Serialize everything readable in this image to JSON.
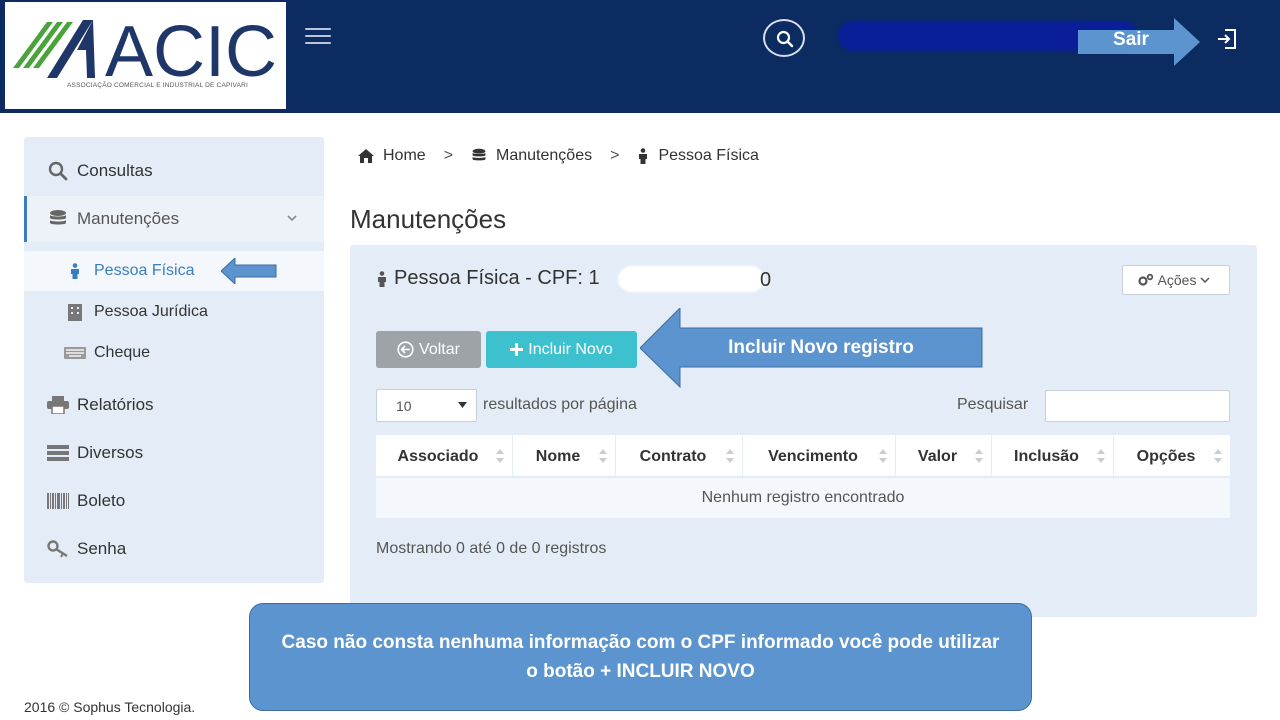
{
  "header": {
    "logo_text": "ACIC",
    "logo_subtitle": "ASSOCIAÇÃO COMERCIAL E INDUSTRIAL DE CAPIVARI",
    "sair_label": "Sair"
  },
  "sidebar": {
    "items": [
      {
        "label": "Consultas",
        "icon": "search-icon"
      },
      {
        "label": "Manutenções",
        "icon": "database-icon"
      },
      {
        "label": "Pessoa Física",
        "icon": "person-icon"
      },
      {
        "label": "Pessoa Jurídica",
        "icon": "building-icon"
      },
      {
        "label": "Cheque",
        "icon": "keyboard-icon"
      },
      {
        "label": "Relatórios",
        "icon": "printer-icon"
      },
      {
        "label": "Diversos",
        "icon": "server-icon"
      },
      {
        "label": "Boleto",
        "icon": "barcode-icon"
      },
      {
        "label": "Senha",
        "icon": "key-icon"
      }
    ]
  },
  "breadcrumb": {
    "items": [
      {
        "label": "Home",
        "icon": "home-icon"
      },
      {
        "label": "Manutenções",
        "icon": "database-icon"
      },
      {
        "label": "Pessoa Física",
        "icon": "person-icon"
      }
    ],
    "separator": ">"
  },
  "page": {
    "title": "Manutenções"
  },
  "panel": {
    "title": "Pessoa Física - CPF: 1",
    "cpf_end": "0",
    "acoes_label": "Ações",
    "voltar_label": "Voltar",
    "novo_label": "Incluir Novo",
    "length_value": "10",
    "length_label": "resultados por página",
    "search_label": "Pesquisar",
    "search_value": "",
    "columns": [
      "Associado",
      "Nome",
      "Contrato",
      "Vencimento",
      "Valor",
      "Inclusão",
      "Opções"
    ],
    "empty_text": "Nenhum registro encontrado",
    "info_text": "Mostrando 0 até 0 de 0 registros"
  },
  "annotations": {
    "incluir_arrow": "Incluir Novo registro",
    "bottom_callout": "Caso não consta nenhuma informação com o CPF informado você pode utilizar o botão + INCLUIR NOVO"
  },
  "footer": {
    "text": "2016 © Sophus Tecnologia."
  },
  "colors": {
    "header_bg": "#0c2b60",
    "panel_bg": "#e4edf7",
    "novo_button": "#3ec1cf",
    "voltar_button": "#9ea3a8",
    "annotation_blue": "#5b94ce",
    "logo_green": "#4aa33a",
    "logo_navy": "#1f3669"
  }
}
